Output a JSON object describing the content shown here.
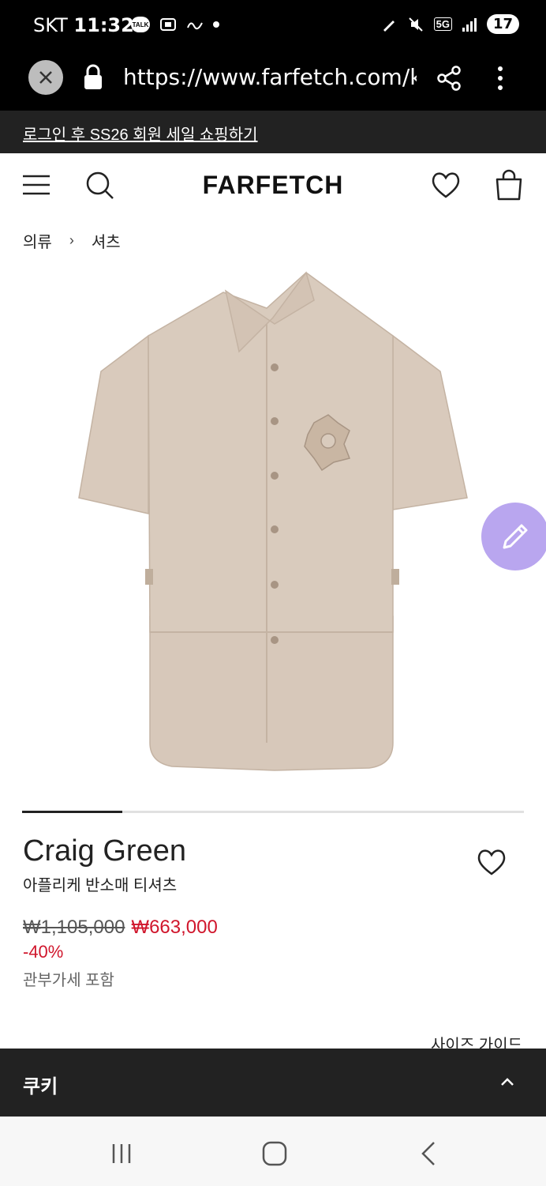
{
  "status_bar": {
    "carrier": "SKT",
    "time": "11:32",
    "talk_badge": "TALK",
    "network": "5G",
    "battery": "17"
  },
  "browser": {
    "url": "https://www.farfetch.com/kr/"
  },
  "promo_banner": {
    "text": "로그인 후 SS26 회원 세일 쇼핑하기"
  },
  "header": {
    "logo": "FARFETCH"
  },
  "breadcrumb": {
    "items": [
      "의류",
      "셔츠"
    ],
    "separator": "›"
  },
  "gallery": {
    "progress_fraction": 0.2
  },
  "product": {
    "brand": "Craig Green",
    "name": "아플리케 반소매 티셔츠",
    "original_price": "₩1,105,000",
    "sale_price": "₩663,000",
    "discount": "-40%",
    "tax_note": "관부가세 포함",
    "size_guide": "사이즈 가이드"
  },
  "cookie_bar": {
    "title": "쿠키"
  },
  "colors": {
    "accent_sale": "#d0162c",
    "fab": "#b9a6ef",
    "shirt": "#d7c8ba"
  }
}
